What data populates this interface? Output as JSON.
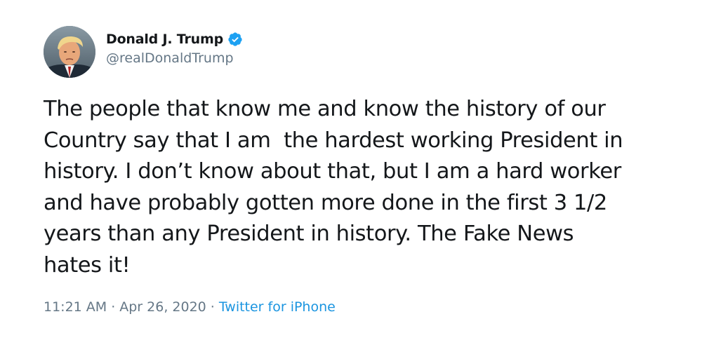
{
  "tweet": {
    "user": {
      "display_name": "Donald J. Trump",
      "handle": "@realDonaldTrump",
      "verified": true
    },
    "text": "The people that know me and know the history of our\nCountry say that I am  the hardest working President in\nhistory. I don’t know about that, but I am a hard worker\nand have probably gotten more done in the first 3 1/2\nyears than any President in history. The Fake News\nhates it!",
    "time": "11:21 AM",
    "date": "Apr 26, 2020",
    "separator": "·",
    "source": "Twitter for iPhone"
  },
  "colors": {
    "text": "#14171a",
    "secondary": "#657786",
    "link": "#1b95e0",
    "verified_badge": "#1da1f2"
  },
  "icons": {
    "avatar": "profile-photo",
    "verified": "verified-badge-icon"
  }
}
